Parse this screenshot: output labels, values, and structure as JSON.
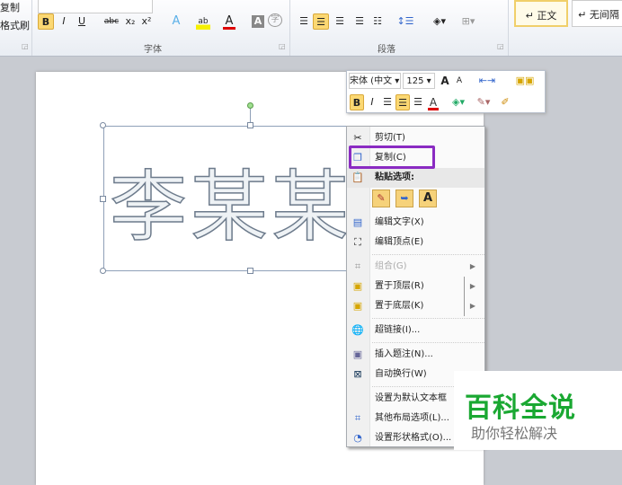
{
  "ribbon": {
    "clipboard": {
      "copy": "复制",
      "format_painter": "格式刷"
    },
    "font_group_label": "字体",
    "paragraph_group_label": "段落",
    "font_buttons": {
      "bold": "B",
      "italic": "I",
      "underline": "U",
      "strike": "abc",
      "sub": "x₂",
      "sup": "x²",
      "text_effect": "A",
      "highlight": "ab",
      "font_color": "A",
      "char_shade": "A",
      "enclose": "字"
    },
    "styles": [
      {
        "label": "↵ 正文"
      },
      {
        "label": "↵ 无间隔"
      }
    ]
  },
  "document": {
    "textbox_text": "李某某"
  },
  "mini_toolbar": {
    "font": "宋体 (中文 ▾",
    "size": "125 ▾",
    "grow": "A",
    "shrink": "A",
    "bold": "B",
    "italic": "I",
    "font_color": "A"
  },
  "context_menu": {
    "items": [
      {
        "label": "剪切(T)",
        "icon": "scissors-icon"
      },
      {
        "label": "复制(C)",
        "icon": "copy-icon"
      },
      {
        "label": "粘贴选项:",
        "icon": "paste-icon"
      },
      {
        "label": "编辑文字(X)",
        "icon": "edit-text-icon"
      },
      {
        "label": "编辑顶点(E)",
        "icon": "edit-points-icon"
      },
      {
        "label": "组合(G)",
        "icon": "group-icon"
      },
      {
        "label": "置于顶层(R)",
        "icon": "bring-front-icon"
      },
      {
        "label": "置于底层(K)",
        "icon": "send-back-icon"
      },
      {
        "label": "超链接(I)...",
        "icon": "hyperlink-icon"
      },
      {
        "label": "插入题注(N)...",
        "icon": "caption-icon"
      },
      {
        "label": "自动换行(W)",
        "icon": "wrap-icon"
      },
      {
        "label": "设置为默认文本框",
        "icon": ""
      },
      {
        "label": "其他布局选项(L)...",
        "icon": "layout-icon"
      },
      {
        "label": "设置形状格式(O)...",
        "icon": "format-shape-icon"
      }
    ],
    "paste_option_a": "A"
  },
  "watermark": {
    "title": "百科全说",
    "subtitle": "助你轻松解决",
    "title_color": "#1aa832"
  }
}
